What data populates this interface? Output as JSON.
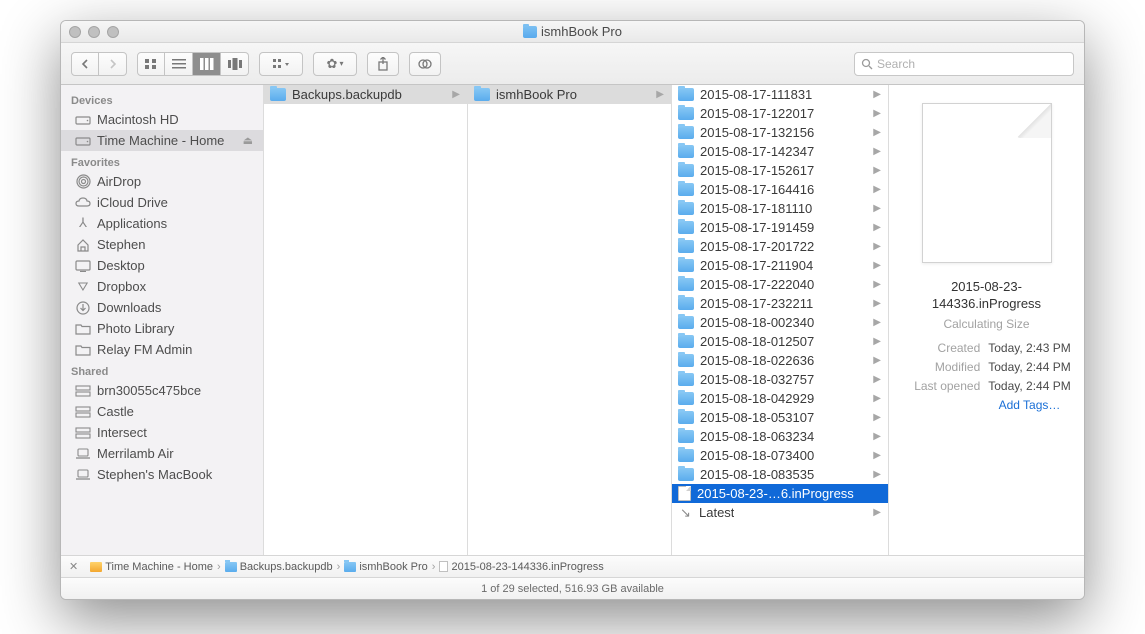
{
  "title": "ismhBook Pro",
  "search": {
    "placeholder": "Search"
  },
  "sidebar": {
    "groups": [
      {
        "heading": "Devices",
        "items": [
          {
            "label": "Macintosh HD",
            "icon": "hdd-icon"
          },
          {
            "label": "Time Machine - Home",
            "icon": "hdd-icon",
            "selected": true,
            "eject": true
          }
        ]
      },
      {
        "heading": "Favorites",
        "items": [
          {
            "label": "AirDrop",
            "icon": "airdrop-icon"
          },
          {
            "label": "iCloud Drive",
            "icon": "cloud-icon"
          },
          {
            "label": "Applications",
            "icon": "apps-icon"
          },
          {
            "label": "Stephen",
            "icon": "home-icon"
          },
          {
            "label": "Desktop",
            "icon": "desktop-icon"
          },
          {
            "label": "Dropbox",
            "icon": "dropbox-icon"
          },
          {
            "label": "Downloads",
            "icon": "downloads-icon"
          },
          {
            "label": "Photo Library",
            "icon": "folder-icon"
          },
          {
            "label": "Relay FM Admin",
            "icon": "folder-icon"
          }
        ]
      },
      {
        "heading": "Shared",
        "items": [
          {
            "label": "brn30055c475bce",
            "icon": "server-icon"
          },
          {
            "label": "Castle",
            "icon": "server-icon"
          },
          {
            "label": "Intersect",
            "icon": "server-icon"
          },
          {
            "label": "Merrilamb Air",
            "icon": "laptop-icon"
          },
          {
            "label": "Stephen's MacBook",
            "icon": "laptop-icon"
          }
        ]
      }
    ]
  },
  "columns": {
    "col1": [
      {
        "label": "Backups.backupdb",
        "type": "folder",
        "selected": true,
        "hasChildren": true
      }
    ],
    "col2": [
      {
        "label": "ismhBook Pro",
        "type": "folder",
        "selected": true,
        "hasChildren": true
      }
    ],
    "col3": [
      {
        "label": "2015-08-17-111831",
        "type": "folder",
        "hasChildren": true
      },
      {
        "label": "2015-08-17-122017",
        "type": "folder",
        "hasChildren": true
      },
      {
        "label": "2015-08-17-132156",
        "type": "folder",
        "hasChildren": true
      },
      {
        "label": "2015-08-17-142347",
        "type": "folder",
        "hasChildren": true
      },
      {
        "label": "2015-08-17-152617",
        "type": "folder",
        "hasChildren": true
      },
      {
        "label": "2015-08-17-164416",
        "type": "folder",
        "hasChildren": true
      },
      {
        "label": "2015-08-17-181110",
        "type": "folder",
        "hasChildren": true
      },
      {
        "label": "2015-08-17-191459",
        "type": "folder",
        "hasChildren": true
      },
      {
        "label": "2015-08-17-201722",
        "type": "folder",
        "hasChildren": true
      },
      {
        "label": "2015-08-17-211904",
        "type": "folder",
        "hasChildren": true
      },
      {
        "label": "2015-08-17-222040",
        "type": "folder",
        "hasChildren": true
      },
      {
        "label": "2015-08-17-232211",
        "type": "folder",
        "hasChildren": true
      },
      {
        "label": "2015-08-18-002340",
        "type": "folder",
        "hasChildren": true
      },
      {
        "label": "2015-08-18-012507",
        "type": "folder",
        "hasChildren": true
      },
      {
        "label": "2015-08-18-022636",
        "type": "folder",
        "hasChildren": true
      },
      {
        "label": "2015-08-18-032757",
        "type": "folder",
        "hasChildren": true
      },
      {
        "label": "2015-08-18-042929",
        "type": "folder",
        "hasChildren": true
      },
      {
        "label": "2015-08-18-053107",
        "type": "folder",
        "hasChildren": true
      },
      {
        "label": "2015-08-18-063234",
        "type": "folder",
        "hasChildren": true
      },
      {
        "label": "2015-08-18-073400",
        "type": "folder",
        "hasChildren": true
      },
      {
        "label": "2015-08-18-083535",
        "type": "folder",
        "hasChildren": true
      },
      {
        "label": "2015-08-23-…6.inProgress",
        "type": "file",
        "selected": true
      },
      {
        "label": "Latest",
        "type": "link",
        "hasChildren": true
      }
    ]
  },
  "preview": {
    "filename": "2015-08-23-144336.inProgress",
    "sizeLabel": "Calculating Size",
    "meta": [
      {
        "label": "Created",
        "value": "Today, 2:43 PM"
      },
      {
        "label": "Modified",
        "value": "Today, 2:44 PM"
      },
      {
        "label": "Last opened",
        "value": "Today, 2:44 PM"
      }
    ],
    "addTags": "Add Tags…"
  },
  "pathbar": [
    {
      "label": "Time Machine - Home",
      "icon": "drive"
    },
    {
      "label": "Backups.backupdb",
      "icon": "folder"
    },
    {
      "label": "ismhBook Pro",
      "icon": "folder"
    },
    {
      "label": "2015-08-23-144336.inProgress",
      "icon": "file"
    }
  ],
  "status": "1 of 29 selected, 516.93 GB available"
}
